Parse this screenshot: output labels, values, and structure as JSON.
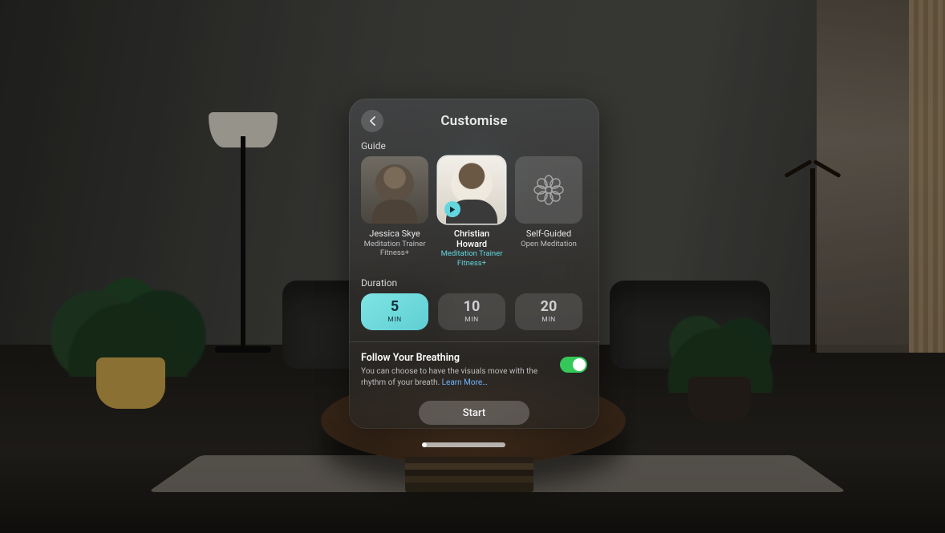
{
  "title": "Customise",
  "sections": {
    "guide_label": "Guide",
    "duration_label": "Duration"
  },
  "guides": [
    {
      "name": "Jessica Skye",
      "subtitle": "Meditation Trainer\nFitness+",
      "selected": false
    },
    {
      "name": "Christian Howard",
      "subtitle": "Meditation Trainer\nFitness+",
      "selected": true
    },
    {
      "name": "Self-Guided",
      "subtitle": "Open Meditation",
      "selected": false
    }
  ],
  "durations": [
    {
      "value": "5",
      "unit": "MIN",
      "selected": true
    },
    {
      "value": "10",
      "unit": "MIN",
      "selected": false
    },
    {
      "value": "20",
      "unit": "MIN",
      "selected": false
    }
  ],
  "breathing": {
    "title": "Follow Your Breathing",
    "description": "You can choose to have the visuals move with the rhythm of your breath. ",
    "learn_more": "Learn More…",
    "enabled": true
  },
  "start_label": "Start",
  "colors": {
    "accent_teal": "#63d7df",
    "toggle_green": "#34c759",
    "link_blue": "#6fb7ff"
  }
}
